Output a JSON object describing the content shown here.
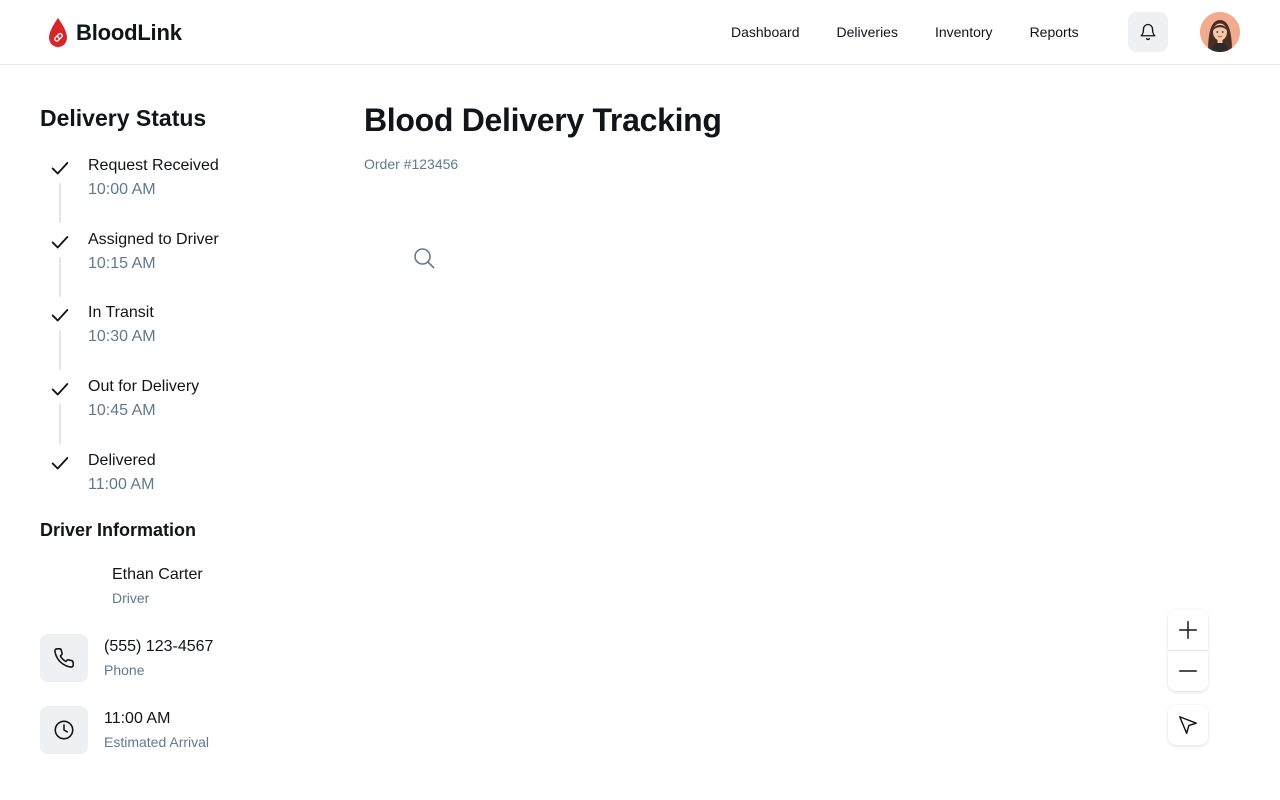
{
  "brand": {
    "name": "BloodLink",
    "accent": "#d7262b"
  },
  "nav": {
    "items": [
      "Dashboard",
      "Deliveries",
      "Inventory",
      "Reports"
    ]
  },
  "header_icons": {
    "notifications": "bell-icon",
    "avatar": "user-avatar"
  },
  "sidebar": {
    "title": "Delivery Status",
    "steps": [
      {
        "label": "Request Received",
        "time": "10:00 AM",
        "done": true
      },
      {
        "label": "Assigned to Driver",
        "time": "10:15 AM",
        "done": true
      },
      {
        "label": "In Transit",
        "time": "10:30 AM",
        "done": true
      },
      {
        "label": "Out for Delivery",
        "time": "10:45 AM",
        "done": true
      },
      {
        "label": "Delivered",
        "time": "11:00 AM",
        "done": true
      }
    ]
  },
  "driver": {
    "title": "Driver Information",
    "name": "Ethan Carter",
    "role": "Driver",
    "phone": {
      "value": "(555) 123-4567",
      "label": "Phone",
      "icon": "phone-icon"
    },
    "eta": {
      "value": "11:00 AM",
      "label": "Estimated Arrival",
      "icon": "clock-icon"
    }
  },
  "main": {
    "title": "Blood Delivery Tracking",
    "order": "Order #123456",
    "search_icon": "search-icon"
  },
  "map_controls": {
    "zoom_in": "plus-icon",
    "zoom_out": "minus-icon",
    "locate": "navigation-arrow-icon"
  },
  "colors": {
    "text": "#111418",
    "muted": "#5f7a8f",
    "icon_bg": "#eef0f3",
    "border": "#e6e8eb"
  }
}
